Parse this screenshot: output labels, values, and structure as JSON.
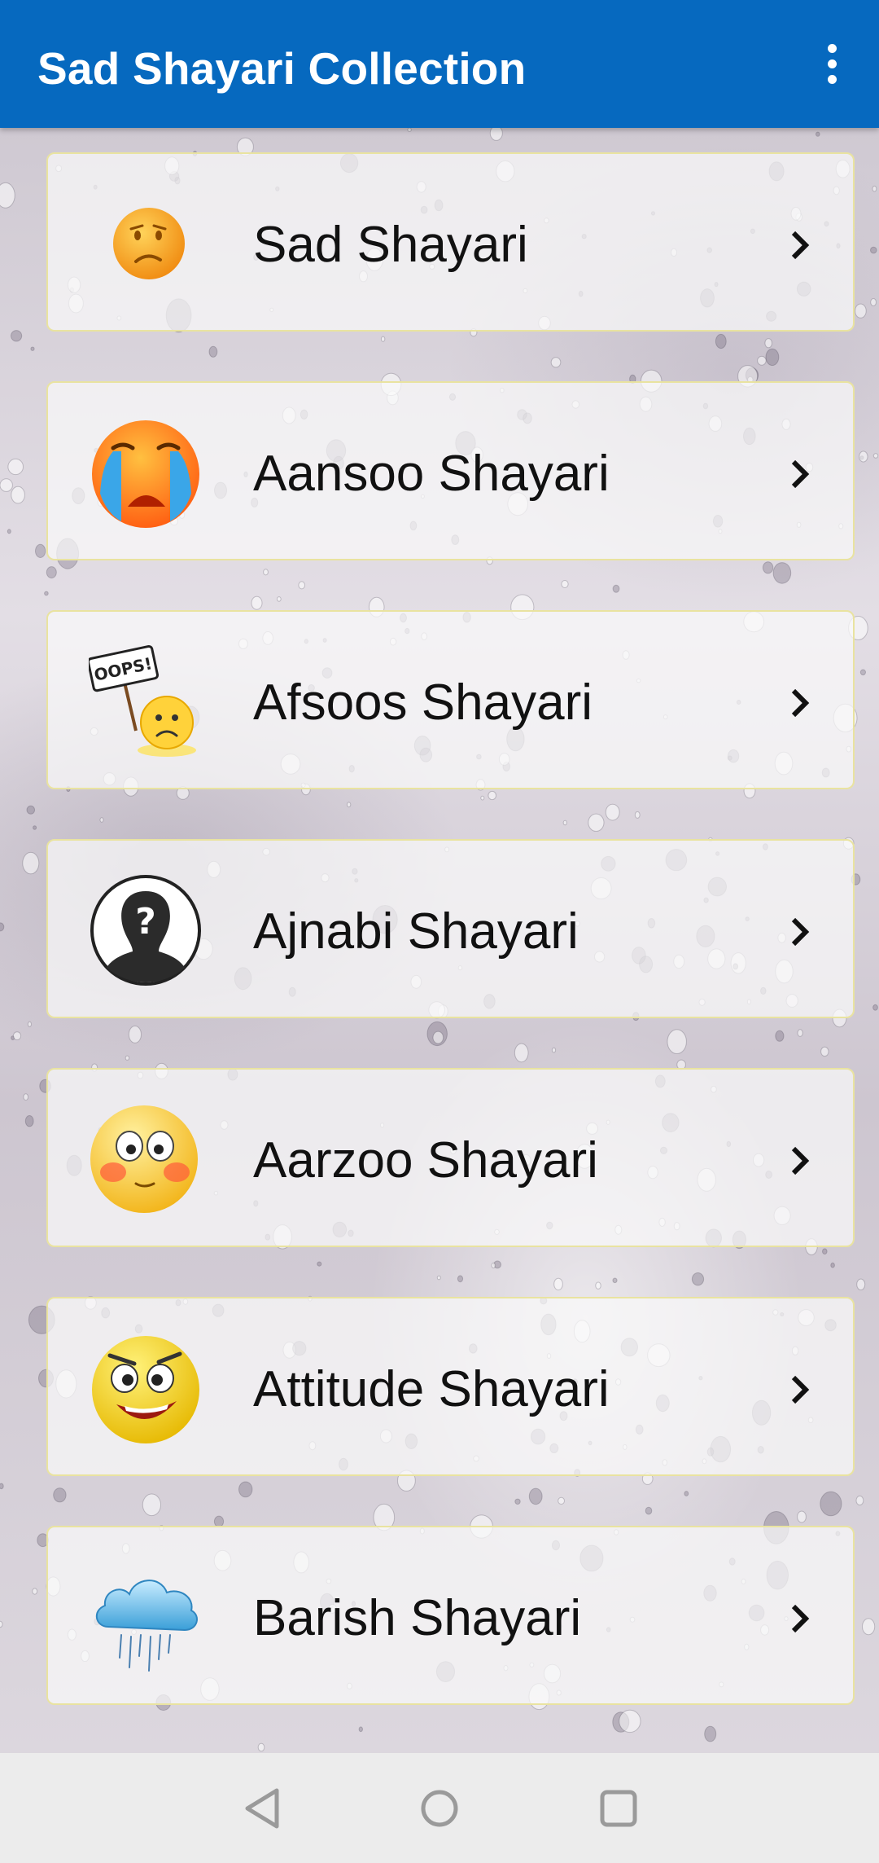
{
  "app_bar": {
    "title": "Sad Shayari Collection",
    "overflow_icon": "more-vert-icon",
    "background_color": "#0669bf"
  },
  "categories": [
    {
      "label": "Sad Shayari",
      "icon": "sad-emoji-icon"
    },
    {
      "label": "Aansoo Shayari",
      "icon": "crying-emoji-icon"
    },
    {
      "label": "Afsoos Shayari",
      "icon": "oops-sign-emoji-icon"
    },
    {
      "label": "Ajnabi Shayari",
      "icon": "unknown-person-icon"
    },
    {
      "label": "Aarzoo Shayari",
      "icon": "blushing-emoji-icon"
    },
    {
      "label": "Attitude Shayari",
      "icon": "attitude-emoji-icon"
    },
    {
      "label": "Barish Shayari",
      "icon": "rain-cloud-icon"
    }
  ],
  "nav_bar": {
    "back_icon": "back-triangle-icon",
    "home_icon": "home-circle-icon",
    "recents_icon": "recents-square-icon"
  },
  "colors": {
    "card_border": "#e9e3a0",
    "nav_background": "#ececec"
  }
}
